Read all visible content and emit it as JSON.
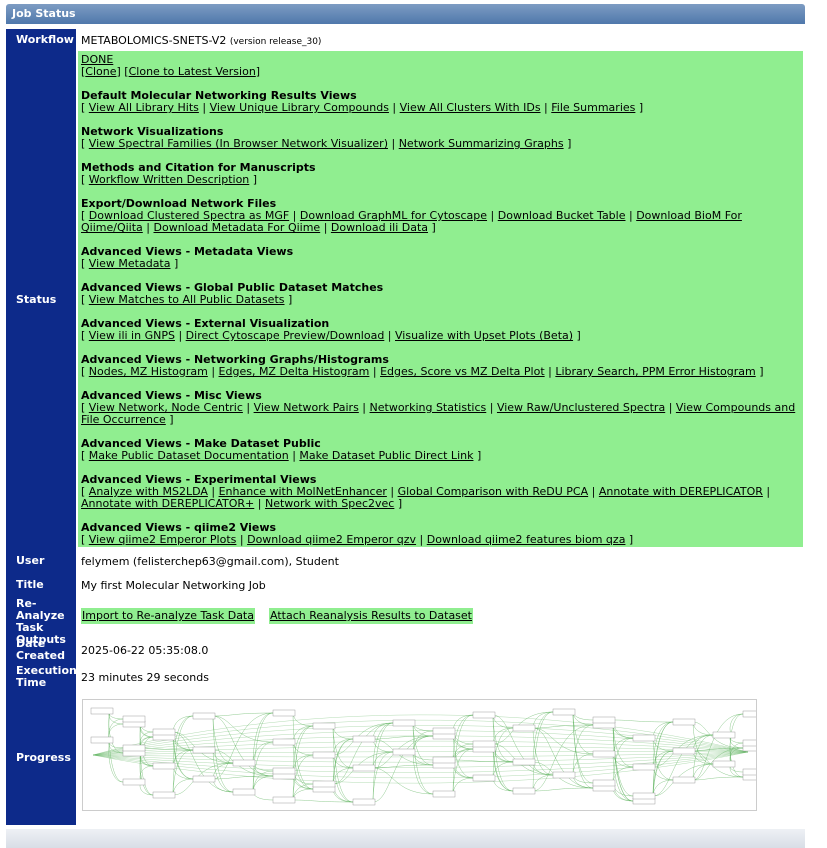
{
  "header": {
    "title": "Job Status"
  },
  "labels": {
    "workflow": "Workflow",
    "status": "Status",
    "user": "User",
    "title": "Title",
    "reanalyze": [
      "Re-Analyze",
      "Task",
      "Outputs"
    ],
    "date_created": [
      "Date",
      "Created"
    ],
    "execution_time": [
      "Execution",
      "Time"
    ],
    "progress": "Progress"
  },
  "workflow": {
    "name": "METABOLOMICS-SNETS-V2",
    "version": "(version release_30)"
  },
  "status": {
    "state": "DONE",
    "clone": "Clone",
    "clone_latest": "Clone to Latest Version",
    "sections": [
      {
        "title": "Default Molecular Networking Results Views",
        "links": [
          "View All Library Hits",
          "View Unique Library Compounds",
          "View All Clusters With IDs",
          "File Summaries"
        ]
      },
      {
        "title": "Network Visualizations",
        "links": [
          "View Spectral Families (In Browser Network Visualizer)",
          "Network Summarizing Graphs"
        ]
      },
      {
        "title": "Methods and Citation for Manuscripts",
        "links": [
          "Workflow Written Description"
        ]
      },
      {
        "title": "Export/Download Network Files",
        "links": [
          "Download Clustered Spectra as MGF",
          "Download GraphML for Cytoscape",
          "Download Bucket Table",
          "Download BioM For Qiime/Qiita",
          "Download Metadata For Qiime",
          "Download ili Data"
        ]
      },
      {
        "title": "Advanced Views - Metadata Views",
        "links": [
          "View Metadata"
        ]
      },
      {
        "title": "Advanced Views - Global Public Dataset Matches",
        "links": [
          "View Matches to All Public Datasets"
        ]
      },
      {
        "title": "Advanced Views - External Visualization",
        "links": [
          "View ili in GNPS",
          "Direct Cytoscape Preview/Download",
          "Visualize with Upset Plots (Beta)"
        ]
      },
      {
        "title": "Advanced Views - Networking Graphs/Histograms",
        "links": [
          "Nodes, MZ Histogram",
          "Edges, MZ Delta Histogram",
          "Edges, Score vs MZ Delta Plot",
          "Library Search, PPM Error Histogram"
        ]
      },
      {
        "title": "Advanced Views - Misc Views",
        "links": [
          "View Network, Node Centric",
          "View Network Pairs",
          "Networking Statistics",
          "View Raw/Unclustered Spectra",
          "View Compounds and File Occurrence"
        ]
      },
      {
        "title": "Advanced Views - Make Dataset Public",
        "links": [
          "Make Public Dataset Documentation",
          "Make Dataset Public Direct Link"
        ]
      },
      {
        "title": "Advanced Views - Experimental Views",
        "links": [
          "Analyze with MS2LDA",
          "Enhance with MolNetEnhancer",
          "Global Comparison with ReDU PCA",
          "Annotate with DEREPLICATOR",
          "Annotate with DEREPLICATOR+",
          "Network with Spec2vec"
        ]
      },
      {
        "title": "Advanced Views - qiime2 Views",
        "links": [
          "View qiime2 Emperor Plots",
          "Download qiime2 Emperor qzv",
          "Download qiime2 features biom qza"
        ]
      }
    ]
  },
  "user": "felymem (felisterchep63@gmail.com), Student",
  "title": "My first Molecular Networking Job",
  "reanalyze": {
    "import": "Import to Re-analyze Task Data",
    "attach": "Attach Reanalysis Results to Dataset"
  },
  "date_created": "2025-06-22 05:35:08.0",
  "execution_time": "23 minutes 29 seconds",
  "colors": {
    "left_col": "#0d2a8a",
    "status_bg": "#90ee90",
    "header": "#5b82b3",
    "graph_edge": "#5fb45f"
  }
}
